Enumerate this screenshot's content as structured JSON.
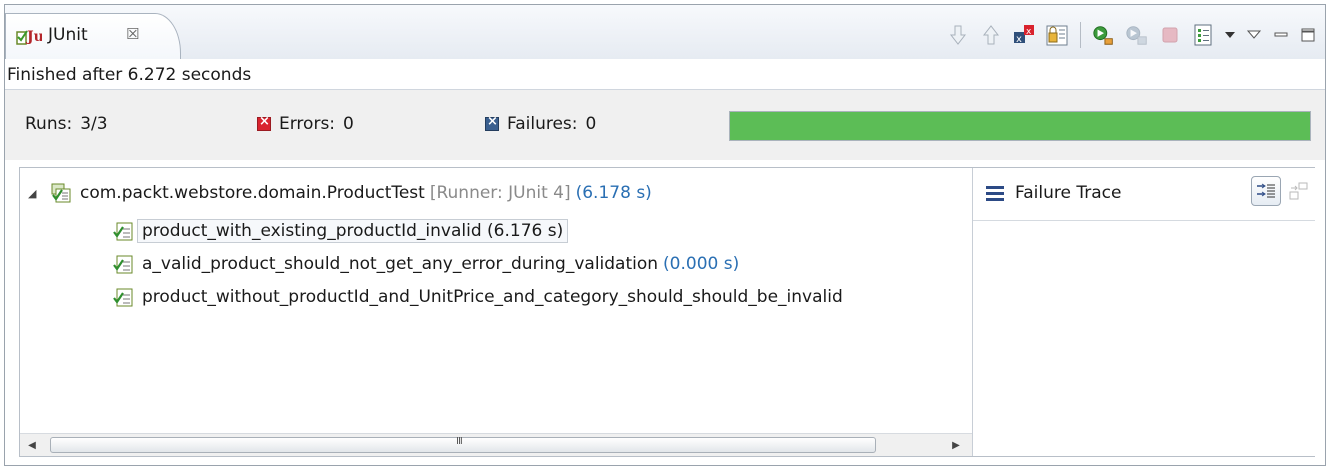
{
  "tab": {
    "title": "JUnit",
    "close_glyph": "☒"
  },
  "toolbar": {
    "icons": [
      "next-failure-icon",
      "previous-failure-icon",
      "show-failures-only-icon",
      "scroll-lock-icon",
      "rerun-icon",
      "rerun-failed-first-icon",
      "stop-icon",
      "history-icon",
      "view-menu-icon",
      "minimize-icon",
      "maximize-icon"
    ]
  },
  "status": {
    "text": "Finished after 6.272 seconds"
  },
  "counters": {
    "runs_label": "Runs:",
    "runs_value": "3/3",
    "errors_label": "Errors:",
    "errors_value": "0",
    "failures_label": "Failures:",
    "failures_value": "0",
    "progress_fraction": 1.0,
    "progress_color": "#5cbd56"
  },
  "tree": {
    "suite": {
      "name": "com.packt.webstore.domain.ProductTest",
      "runner": "[Runner: JUnit 4]",
      "time": "(6.178 s)"
    },
    "tests": [
      {
        "name": "product_with_existing_productId_invalid",
        "time": "(6.176 s)",
        "selected": true
      },
      {
        "name": "a_valid_product_should_not_get_any_error_during_validation",
        "time": "(0.000 s)",
        "selected": false
      },
      {
        "name": "product_without_productId_and_UnitPrice_and_category_should_should_be_invalid",
        "time": "",
        "selected": false
      }
    ]
  },
  "scrollbar": {
    "grip": "III"
  },
  "trace": {
    "title": "Failure Trace"
  }
}
